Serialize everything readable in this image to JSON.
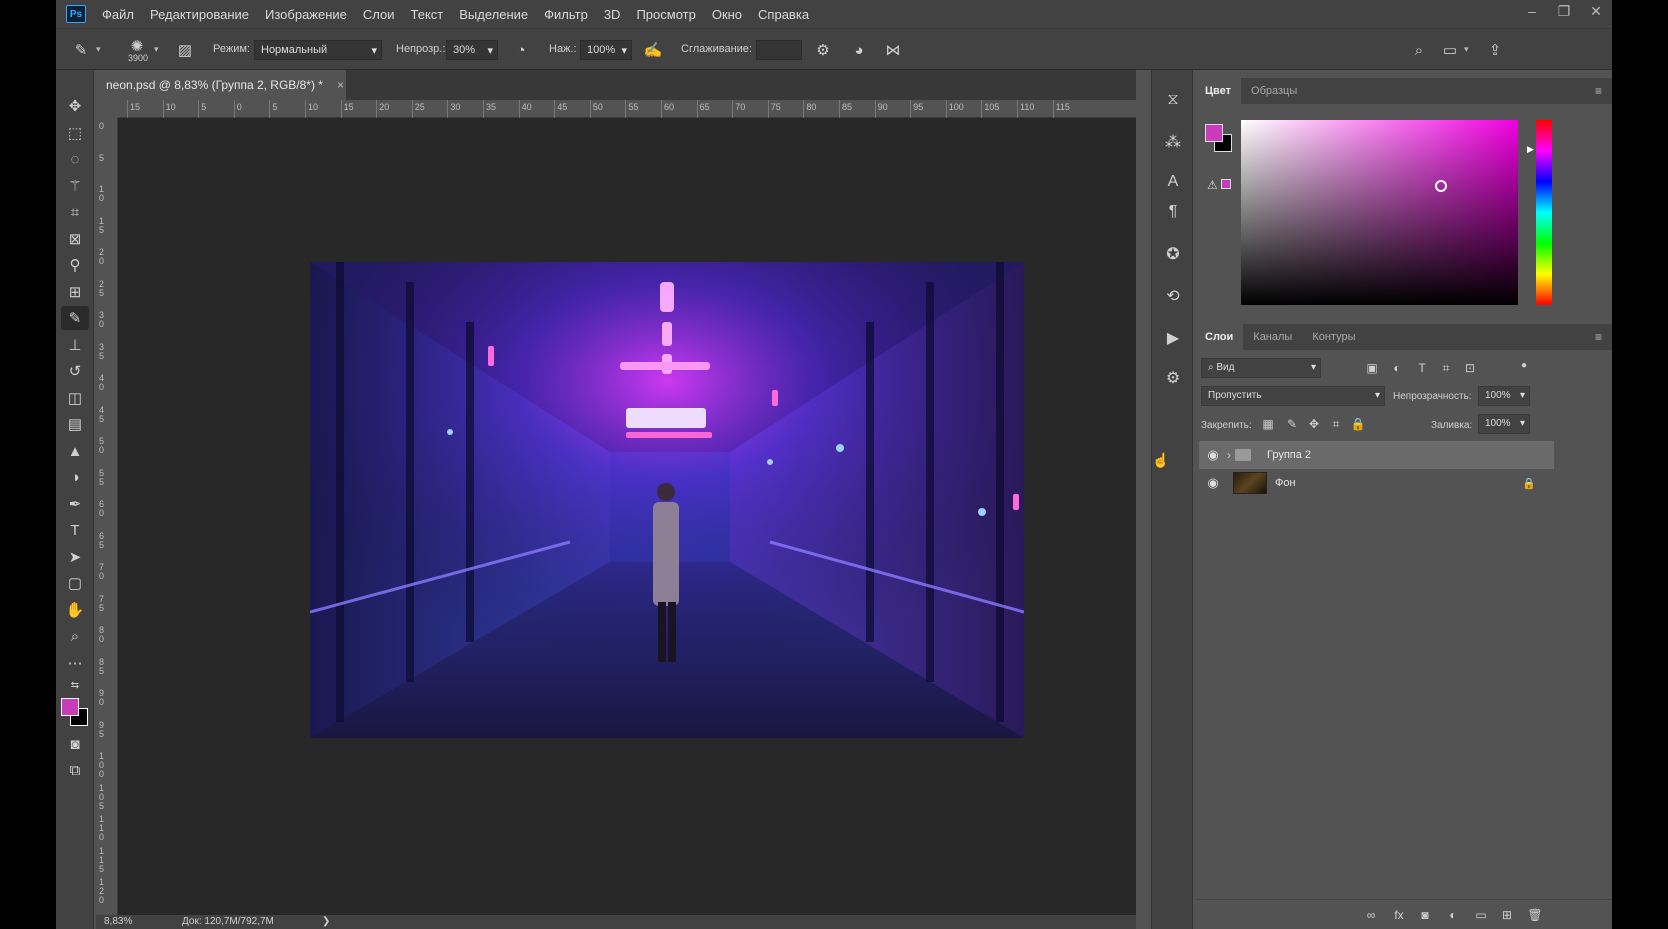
{
  "app": {
    "logo": "Ps",
    "menu": [
      "Файл",
      "Редактирование",
      "Изображение",
      "Слои",
      "Текст",
      "Выделение",
      "Фильтр",
      "3D",
      "Просмотр",
      "Окно",
      "Справка"
    ],
    "window_controls": {
      "minimize": "–",
      "restore": "❐",
      "close": "✕"
    }
  },
  "options": {
    "brush_size": "3900",
    "mode_label": "Режим:",
    "mode_value": "Нормальный",
    "opacity_label": "Непрозр.:",
    "opacity_value": "30%",
    "flow_label": "Наж.:",
    "flow_value": "100%",
    "smoothing_label": "Сглаживание:",
    "smoothing_value": ""
  },
  "document": {
    "tab_title": "neon.psd @ 8,83% (Группа 2, RGB/8*) *",
    "close": "×",
    "ruler_h": [
      "15",
      "10",
      "5",
      "0",
      "5",
      "10",
      "15",
      "20",
      "25",
      "30",
      "35",
      "40",
      "45",
      "50",
      "55",
      "60",
      "65",
      "70",
      "75",
      "80",
      "85",
      "90",
      "95",
      "100",
      "105",
      "110",
      "115"
    ],
    "ruler_v": [
      "0",
      "5",
      "1 0",
      "1 5",
      "2 0",
      "2 5",
      "3 0",
      "3 5",
      "4 0",
      "4 5",
      "5 0",
      "5 5",
      "6 0",
      "6 5",
      "7 0",
      "7 5",
      "8 0",
      "8 5",
      "9 0",
      "9 5",
      "1 0 0",
      "1 0 5",
      "1 1 0",
      "1 1 5",
      "1 2 0"
    ]
  },
  "status": {
    "zoom": "8,83%",
    "doc_info": "Док: 120,7M/792,7M",
    "arrow": "❯"
  },
  "color_panel": {
    "tabs": [
      "Цвет",
      "Образцы"
    ],
    "active_tab": 0,
    "foreground": "#c83cba",
    "background": "#000000"
  },
  "layers_panel": {
    "tabs": [
      "Слои",
      "Каналы",
      "Контуры"
    ],
    "active_tab": 0,
    "filter_label": "Вид",
    "blend_mode": "Пропустить",
    "opacity_label": "Непрозрачность:",
    "opacity_value": "100%",
    "lock_label": "Закрепить:",
    "fill_label": "Заливка:",
    "fill_value": "100%",
    "layers": [
      {
        "name": "Группа 2",
        "type": "group",
        "selected": true
      },
      {
        "name": "Фон",
        "type": "image",
        "locked": true
      }
    ]
  },
  "icons": {
    "chevron": "›",
    "eye": "◉",
    "lock": "🔒"
  }
}
